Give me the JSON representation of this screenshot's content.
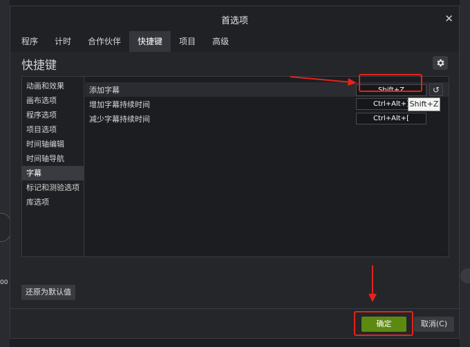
{
  "dialog": {
    "title": "首选项"
  },
  "tabs": [
    {
      "label": "程序"
    },
    {
      "label": "计时"
    },
    {
      "label": "合作伙伴"
    },
    {
      "label": "快捷键",
      "active": true
    },
    {
      "label": "项目"
    },
    {
      "label": "高级"
    }
  ],
  "section": {
    "title": "快捷键"
  },
  "categories": [
    {
      "label": "动画和效果"
    },
    {
      "label": "画布选项"
    },
    {
      "label": "程序选项"
    },
    {
      "label": "项目选项"
    },
    {
      "label": "时间轴编辑"
    },
    {
      "label": "时间轴导航"
    },
    {
      "label": "字幕",
      "selected": true
    },
    {
      "label": "标记和测验选项"
    },
    {
      "label": "库选项"
    }
  ],
  "shortcuts": [
    {
      "label": "添加字幕",
      "key": "Shift+Z"
    },
    {
      "label": "增加字幕持续时间",
      "key": "Ctrl+Alt+]"
    },
    {
      "label": "减少字幕持续时间",
      "key": "Ctrl+Alt+["
    }
  ],
  "tooltip": {
    "text": "Shift+Z"
  },
  "buttons": {
    "restore": "还原为默认值",
    "ok": "确定",
    "cancel": "取消(C)"
  },
  "background": {
    "left_text": "00"
  },
  "colors": {
    "accent_green": "#5c8a11",
    "annotation_red": "#e5231b"
  },
  "icons": {
    "close": "close-icon",
    "gear": "gear-icon",
    "reset": "reset-icon"
  }
}
